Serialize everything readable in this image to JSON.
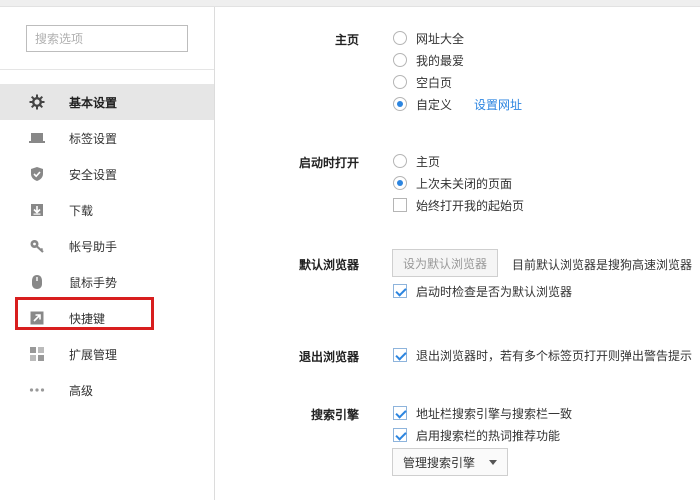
{
  "search": {
    "placeholder": "搜索选项"
  },
  "sidebar": {
    "items": [
      {
        "label": "基本设置",
        "icon": "gear-icon"
      },
      {
        "label": "标签设置",
        "icon": "tab-icon"
      },
      {
        "label": "安全设置",
        "icon": "shield-check-icon"
      },
      {
        "label": "下载",
        "icon": "download-icon"
      },
      {
        "label": "帐号助手",
        "icon": "key-icon"
      },
      {
        "label": "鼠标手势",
        "icon": "mouse-icon"
      },
      {
        "label": "快捷键",
        "icon": "shortcut-arrow-icon"
      },
      {
        "label": "扩展管理",
        "icon": "grid-icon"
      },
      {
        "label": "高级",
        "icon": "more-dots-icon"
      }
    ],
    "active_index": 0,
    "highlighted_index": 6
  },
  "homepage": {
    "label": "主页",
    "options": [
      "网址大全",
      "我的最爱",
      "空白页",
      "自定义"
    ],
    "selected": "自定义",
    "link": "设置网址"
  },
  "startup": {
    "label": "启动时打开",
    "options": [
      "主页",
      "上次未关闭的页面"
    ],
    "selected": "上次未关闭的页面",
    "checkbox": {
      "label": "始终打开我的起始页",
      "checked": false
    }
  },
  "default_browser": {
    "label": "默认浏览器",
    "button": "设为默认浏览器",
    "status": "目前默认浏览器是搜狗高速浏览器",
    "checkbox": {
      "label": "启动时检查是否为默认浏览器",
      "checked": true
    }
  },
  "exit_browser": {
    "label": "退出浏览器",
    "checkbox": {
      "label": "退出浏览器时，若有多个标签页打开则弹出警告提示",
      "checked": true
    }
  },
  "search_engine": {
    "label": "搜索引擎",
    "checkboxes": [
      {
        "label": "地址栏搜索引擎与搜索栏一致",
        "checked": true
      },
      {
        "label": "启用搜索栏的热词推荐功能",
        "checked": true
      }
    ],
    "manage_button": "管理搜索引擎"
  },
  "colors": {
    "accent": "#2c85e0",
    "highlight": "#d81e1e",
    "active_bg": "#e6e6e6"
  }
}
